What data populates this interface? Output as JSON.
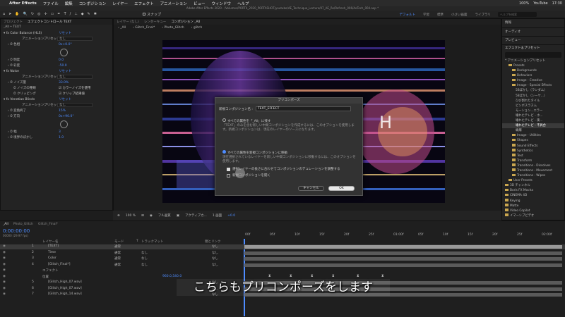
{
  "mac_menu": {
    "apple": "",
    "app": "After Effects",
    "items": [
      "ファイル",
      "編集",
      "コンポジション",
      "レイヤー",
      "エフェクト",
      "アニメーション",
      "ビュー",
      "ウィンドウ",
      "ヘルプ"
    ],
    "status": {
      "battery": "100%",
      "youtube": "YouTube",
      "time": "17:30"
    }
  },
  "window_title": "Adobe After Effects 2020 - /Volumes/PORT4_2020_PORTASHOT/youtube/AE_Technique_Lecture/07_AE_Re/Refresh_006/AeTech_004.aep *",
  "toolbar": {
    "snap_label": "スナップ"
  },
  "workspaces": {
    "items": [
      "デフォルト",
      "学習",
      "標準",
      "小さい画面",
      "ライブラリ"
    ],
    "active": "デフォルト"
  },
  "search": {
    "placeholder": "ヘルプを検索"
  },
  "left_panel": {
    "tab1": "プロジェクト",
    "tab2": "エフェクトコントロール TEXT",
    "layer_path": "_All • TEXT",
    "effects": [
      {
        "kind": "header",
        "label": "Color Balance (HLS)",
        "reset": "リセット"
      },
      {
        "kind": "dd",
        "label": "アニメーションプリセット",
        "value": "なし"
      },
      {
        "kind": "val",
        "label": "色相",
        "value": "0x+0.0°"
      },
      {
        "kind": "knob"
      },
      {
        "kind": "val",
        "label": "明度",
        "value": "0.0"
      },
      {
        "kind": "val",
        "label": "彩度",
        "value": "-50.0"
      },
      {
        "kind": "header",
        "label": "Noise",
        "reset": "リセット"
      },
      {
        "kind": "dd",
        "label": "アニメーションプリセット",
        "value": "なし"
      },
      {
        "kind": "val",
        "label": "ノイズ量",
        "value": "33.0%"
      },
      {
        "kind": "check",
        "label": "ノイズの種類",
        "value": "カラーノイズを使用"
      },
      {
        "kind": "check",
        "label": "クリッピング",
        "value": "クリップ結果値"
      },
      {
        "kind": "header",
        "label": "Venetian Blinds",
        "reset": "リセット"
      },
      {
        "kind": "dd",
        "label": "アニメーションプリセット",
        "value": "なし"
      },
      {
        "kind": "val",
        "label": "変換終了",
        "value": "15%"
      },
      {
        "kind": "val",
        "label": "方向",
        "value": "0x+90.0°"
      },
      {
        "kind": "knob"
      },
      {
        "kind": "val",
        "label": "幅",
        "value": "3"
      },
      {
        "kind": "val",
        "label": "境界のぼかし",
        "value": "1.0"
      }
    ]
  },
  "viewer": {
    "tabs": {
      "layer": "レイヤー (なし)",
      "render": "レンダーキュー",
      "comp": "コンポジション _All"
    },
    "crumbs": [
      "_All",
      "Glitch_Final*",
      "Photo_Glitch",
      "glitch"
    ],
    "zoom": "100 %",
    "res": "フル画質",
    "cam": "アクティブカ...",
    "views": "1 画面",
    "offset": "+0.0"
  },
  "dialog": {
    "title": "プリコンポーズ",
    "name_label": "新規コンポジション名 :",
    "name_value": "TEXT_EFFECT",
    "option1": "すべての属性を「_All」に残す",
    "option1_desc": "「TEXT」のみを含む新しい中間コンポジションを作成するには、このオプションを使用します。新規コンポジションは、現在のレイヤーのソースになります。",
    "option2": "すべての属性を新規コンポジションに移動",
    "option2_desc": "現在選択されているレイヤーを新しい中間コンポジションに移動するには、このオプションを使用します。",
    "check1": "選択レイヤーの長さに合わせてコンポジションのデュレーションを調整する",
    "check2": "新規コンポジションを開く",
    "cancel": "キャンセル",
    "ok": "OK"
  },
  "right_panel": {
    "info": "情報",
    "audio": "オーディオ",
    "preview": "プレビュー",
    "effects_title": "エフェクト＆プリセット",
    "anim_presets": "* アニメーションプリセット",
    "tree": [
      {
        "d": 1,
        "t": "Presets"
      },
      {
        "d": 2,
        "t": "Backgrounds"
      },
      {
        "d": 2,
        "t": "Behaviors"
      },
      {
        "d": 2,
        "t": "Image - Creative"
      },
      {
        "d": 2,
        "t": "Image - Special Effects"
      },
      {
        "d": 3,
        "t": "5Bぼかし（ランダム）"
      },
      {
        "d": 3,
        "t": "5Bぼかし（シーケ...）"
      },
      {
        "d": 3,
        "t": "ひび割れたタイル"
      },
      {
        "d": 3,
        "t": "ピンボスラスム"
      },
      {
        "d": 3,
        "t": "モーション...エラー"
      },
      {
        "d": 3,
        "t": "壊れたテレビ - ホ..."
      },
      {
        "d": 3,
        "t": "壊れたテレビ - 衝..."
      },
      {
        "d": 3,
        "t": "壊れたテレビ - 不具合",
        "sel": true
      },
      {
        "d": 3,
        "t": "蝋燭"
      },
      {
        "d": 2,
        "t": "Image - Utilities"
      },
      {
        "d": 2,
        "t": "Shapes"
      },
      {
        "d": 2,
        "t": "Sound Effects"
      },
      {
        "d": 2,
        "t": "Synthetics"
      },
      {
        "d": 2,
        "t": "Text"
      },
      {
        "d": 2,
        "t": "Transform"
      },
      {
        "d": 2,
        "t": "Transitions - Dissolves"
      },
      {
        "d": 2,
        "t": "Transitions - Movement"
      },
      {
        "d": 2,
        "t": "Transitions - Wipes"
      },
      {
        "d": 1,
        "t": "User Presets"
      },
      {
        "d": 0,
        "t": "3D チャンネル"
      },
      {
        "d": 0,
        "t": "Boris FX Mocha"
      },
      {
        "d": 0,
        "t": "CINEMA 4D"
      },
      {
        "d": 0,
        "t": "Keying"
      },
      {
        "d": 0,
        "t": "Matte"
      },
      {
        "d": 0,
        "t": "Video Copilot"
      },
      {
        "d": 0,
        "t": "イマーシブビデオ"
      }
    ]
  },
  "timeline": {
    "tabs": [
      "_All",
      "Photo_Glitch",
      "Glitch_Final*"
    ],
    "timecode": "0:00:00:00",
    "fps": "00000 (29.97 fps)",
    "headers": {
      "layer_name": "レイヤー名",
      "mode": "モード",
      "t": "T",
      "trkmat": "トラックマット",
      "parent": "親とリンク"
    },
    "layers": [
      {
        "n": "1",
        "name": "[TEXT]",
        "mode": "通常",
        "trk": "",
        "parent": "なし",
        "sel": true
      },
      {
        "n": "2",
        "name": "Time",
        "mode": "通常",
        "trk": "なし",
        "parent": "なし"
      },
      {
        "n": "3",
        "name": "Color",
        "mode": "通常",
        "trk": "なし",
        "parent": "なし"
      },
      {
        "n": "4",
        "name": "[Glitch_Final*]",
        "mode": "通常",
        "trk": "なし",
        "parent": "なし"
      },
      {
        "n": "",
        "name": "エフェクト",
        "mode": "",
        "trk": "",
        "parent": ""
      },
      {
        "n": "",
        "name": "位置",
        "mode": "",
        "trk": "",
        "parent": "",
        "val": "960.0,540.0"
      },
      {
        "n": "5",
        "name": "[Glitch_High_07.wav]",
        "mode": "",
        "trk": "",
        "parent": "なし"
      },
      {
        "n": "6",
        "name": "[Glitch_High_07.wav]",
        "mode": "",
        "trk": "",
        "parent": "なし"
      },
      {
        "n": "7",
        "name": "[Glitch_High_14.wav]",
        "mode": "",
        "trk": "",
        "parent": "なし"
      }
    ],
    "ruler": [
      "00f",
      "05f",
      "10f",
      "15f",
      "20f",
      "25f",
      "01:00f",
      "05f",
      "10f",
      "15f",
      "20f",
      "25f",
      "02:00f"
    ]
  },
  "subtitle": "こちらもプリコンポーズをします"
}
